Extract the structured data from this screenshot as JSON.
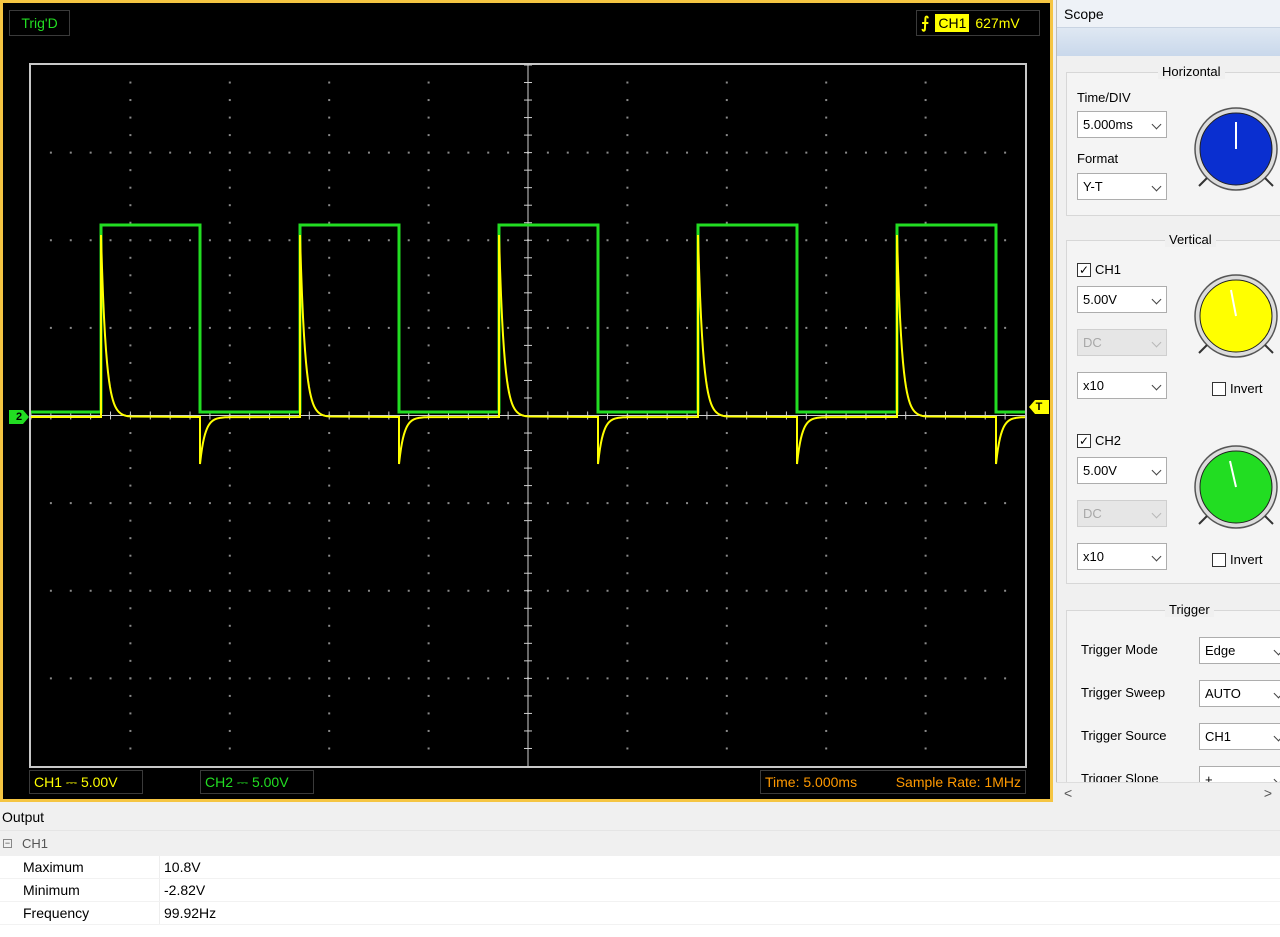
{
  "scope": {
    "trig_status": "Trig'D",
    "trigger_channel": "CH1",
    "trigger_level": "627mV",
    "ch1_marker": "",
    "ch2_marker": "2",
    "trig_marker": "T",
    "ch1_footer": "CH1 ⎓  5.00V",
    "ch2_footer": "CH2 ⎓  5.00V",
    "time_footer": "Time: 5.000ms",
    "sample_rate": "Sample Rate: 1MHz"
  },
  "colors": {
    "ch1": "#ffff00",
    "ch2": "#22dd22",
    "frame": "#f5c542",
    "status_orange": "#ff9900"
  },
  "panel": {
    "title": "Scope",
    "horizontal": {
      "title": "Horizontal",
      "time_div_label": "Time/DIV",
      "time_div_value": "5.000ms",
      "format_label": "Format",
      "format_value": "Y-T",
      "knob_color": "#0a2fd0"
    },
    "vertical": {
      "title": "Vertical",
      "ch1": {
        "label": "CH1",
        "checked": true,
        "volts": "5.00V",
        "coupling": "DC",
        "probe": "x10",
        "invert_label": "Invert",
        "knob_color": "#ffff00"
      },
      "ch2": {
        "label": "CH2",
        "checked": true,
        "volts": "5.00V",
        "coupling": "DC",
        "probe": "x10",
        "invert_label": "Invert",
        "knob_color": "#22dd22"
      }
    },
    "trigger": {
      "title": "Trigger",
      "mode_label": "Trigger Mode",
      "mode_value": "Edge",
      "sweep_label": "Trigger Sweep",
      "sweep_value": "AUTO",
      "source_label": "Trigger Source",
      "source_value": "CH1",
      "slope_label": "Trigger Slope",
      "slope_value": "+"
    }
  },
  "output": {
    "title": "Output",
    "group": "CH1",
    "rows": [
      {
        "key": "Maximum",
        "value": "10.8V"
      },
      {
        "key": "Minimum",
        "value": "-2.82V"
      },
      {
        "key": "Frequency",
        "value": "99.92Hz"
      }
    ]
  }
}
